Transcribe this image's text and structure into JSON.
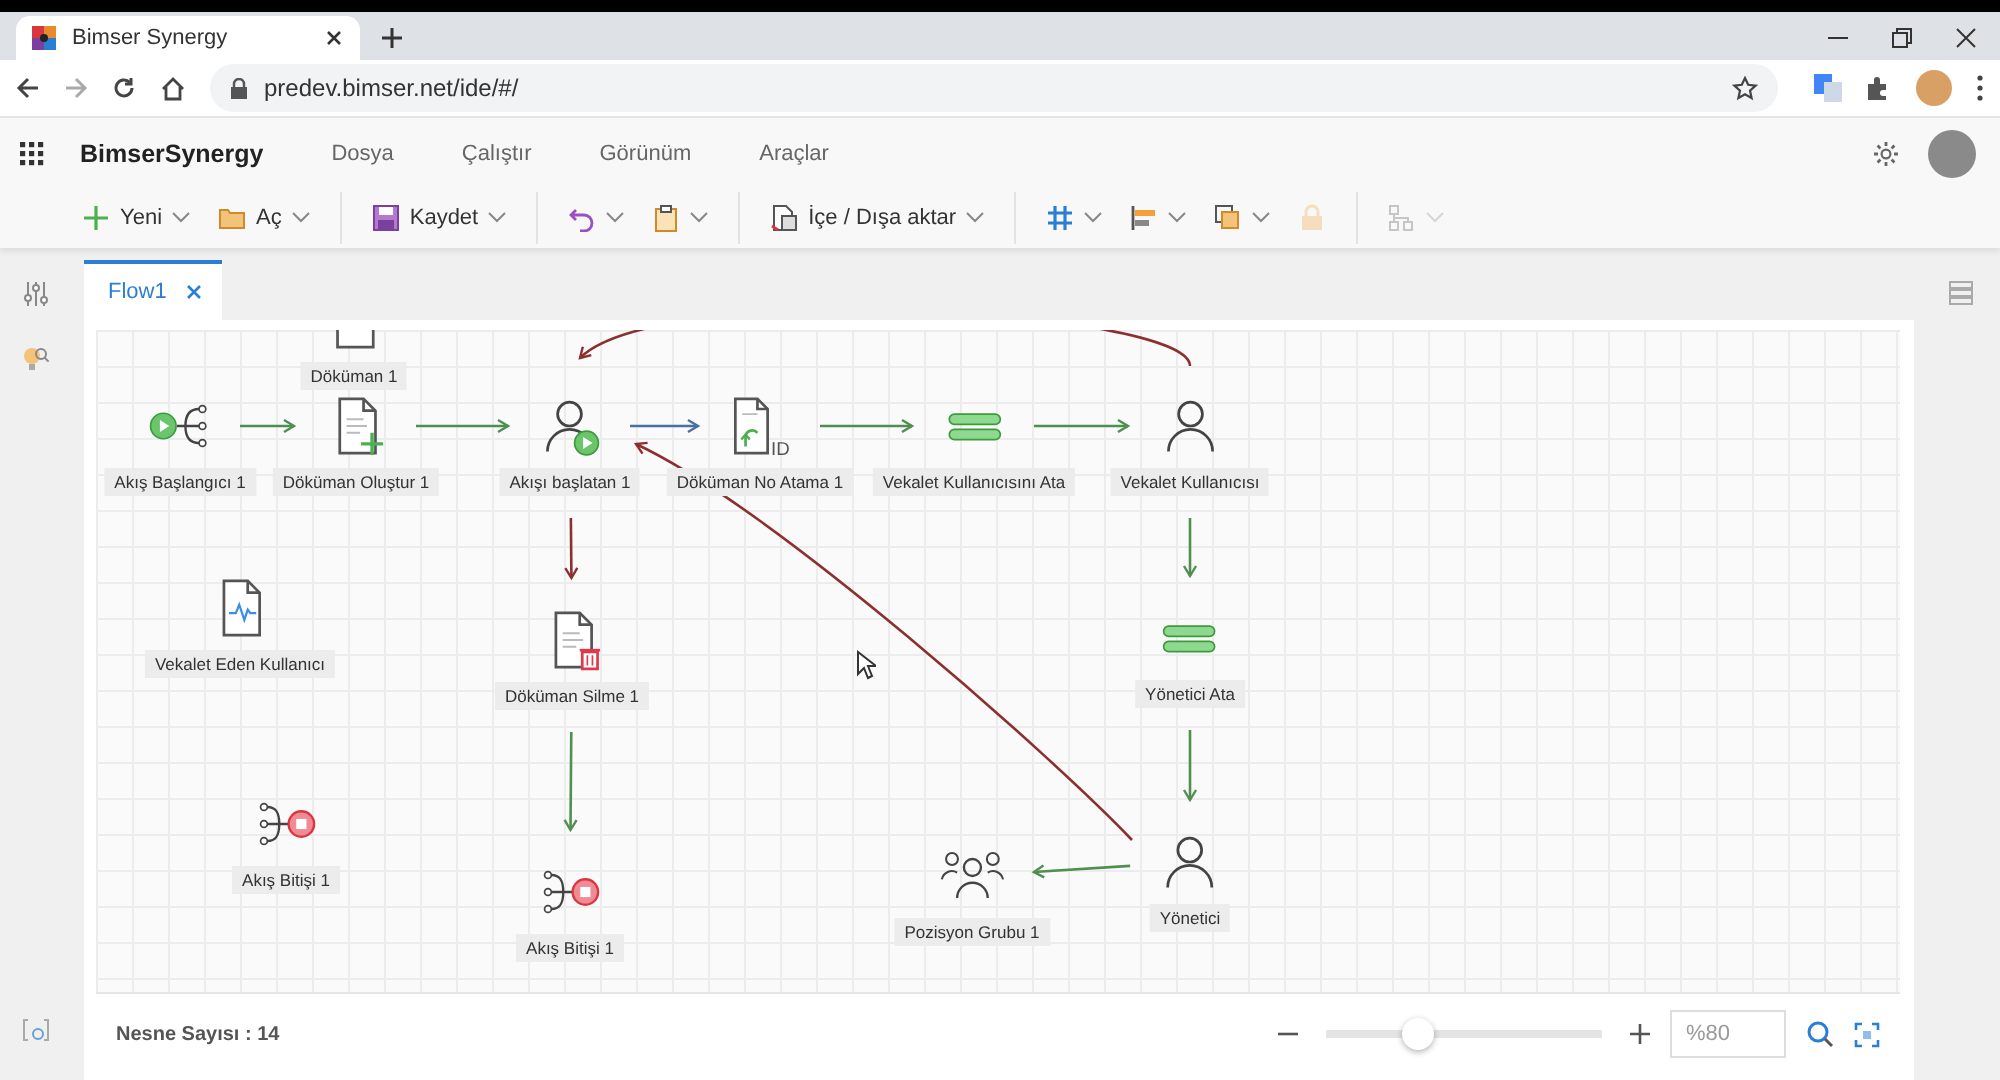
{
  "browser": {
    "tab_title": "Bimser Synergy",
    "url": "predev.bimser.net/ide/#/"
  },
  "app": {
    "brand": "BimserSynergy",
    "menu": [
      {
        "label": "Dosya"
      },
      {
        "label": "Çalıştır"
      },
      {
        "label": "Görünüm"
      },
      {
        "label": "Araçlar"
      }
    ]
  },
  "toolbar": {
    "groups": [
      [
        {
          "kind": "new",
          "label": "Yeni",
          "has_menu": true,
          "disabled": false
        },
        {
          "kind": "open",
          "label": "Aç",
          "has_menu": true,
          "disabled": false
        }
      ],
      [
        {
          "kind": "save",
          "label": "Kaydet",
          "has_menu": true,
          "disabled": false
        }
      ],
      [
        {
          "kind": "undo",
          "has_menu": true,
          "disabled": false
        },
        {
          "kind": "paste",
          "has_menu": true,
          "disabled": false
        }
      ],
      [
        {
          "kind": "import",
          "label": "İçe / Dışa aktar",
          "has_menu": true,
          "disabled": false
        }
      ],
      [
        {
          "kind": "grid",
          "has_menu": true,
          "disabled": false
        },
        {
          "kind": "align",
          "has_menu": true,
          "disabled": false
        },
        {
          "kind": "arrange",
          "has_menu": true,
          "disabled": false
        },
        {
          "kind": "lock",
          "has_menu": false,
          "disabled": true
        }
      ],
      [
        {
          "kind": "hierarchy",
          "has_menu": true,
          "disabled": true
        }
      ]
    ]
  },
  "editor_tabs": [
    {
      "label": "Flow1",
      "selected": true
    }
  ],
  "diagram": {
    "nodes": [
      {
        "label": "Döküman 1",
        "kind": "doc"
      },
      {
        "label": "Akış Başlangıcı 1",
        "kind": "start"
      },
      {
        "label": "Döküman Oluştur 1",
        "kind": "doc-create"
      },
      {
        "label": "Akışı başlatan 1",
        "kind": "user-start"
      },
      {
        "label": "Döküman No Atama 1",
        "kind": "doc-id",
        "icon_text": "ID"
      },
      {
        "label": "Vekalet Kullanıcısını Ata",
        "kind": "assign"
      },
      {
        "label": "Vekalet Kullanıcısı",
        "kind": "user"
      },
      {
        "label": "Vekalet Eden Kullanıcı",
        "kind": "doc-wave"
      },
      {
        "label": "Döküman Silme 1",
        "kind": "doc-delete"
      },
      {
        "label": "Yönetici Ata",
        "kind": "assign"
      },
      {
        "label": "Akış Bitişi 1",
        "kind": "end"
      },
      {
        "label": "Akış Bitişi 1",
        "kind": "end"
      },
      {
        "label": "Pozisyon Grubu 1",
        "kind": "group"
      },
      {
        "label": "Yönetici",
        "kind": "user"
      }
    ],
    "edges": [
      {
        "kind": "straight",
        "color": "#4f8f4f"
      },
      {
        "kind": "straight",
        "color": "#4f8f4f"
      },
      {
        "kind": "straight",
        "color": "#4a6fa5"
      },
      {
        "kind": "straight",
        "color": "#4f8f4f"
      },
      {
        "kind": "straight",
        "color": "#4f8f4f"
      },
      {
        "kind": "straight",
        "color": "#4f8f4f"
      },
      {
        "kind": "straight",
        "color": "#4f8f4f"
      },
      {
        "kind": "straight",
        "color": "#4f8f4f"
      },
      {
        "kind": "straight",
        "color": "#8b2f2f"
      },
      {
        "kind": "straight",
        "color": "#4f8f4f"
      },
      {
        "kind": "curve",
        "color": "#8b2f2f"
      },
      {
        "kind": "loop",
        "color": "#8b2f2f"
      }
    ]
  },
  "footer": {
    "object_count": "Nesne Sayısı : 14",
    "zoom": {
      "level": 0.33,
      "value": "%80"
    }
  }
}
